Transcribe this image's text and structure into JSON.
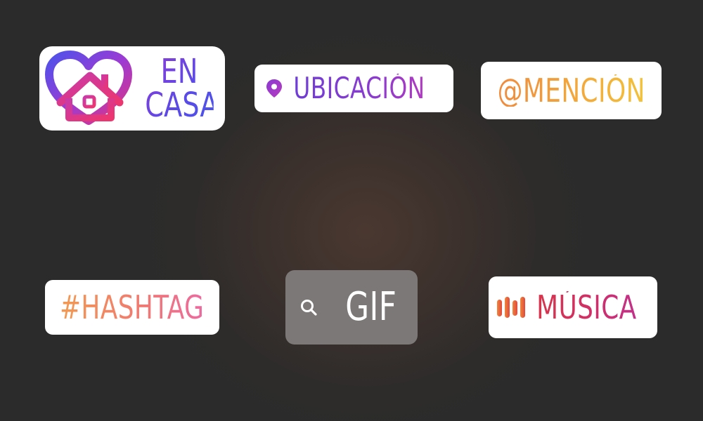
{
  "stickers": {
    "en_casa": {
      "line1": "EN",
      "line2": "CASA",
      "icon": "heart-house-icon"
    },
    "ubicacion": {
      "label": "UBICACIÓN",
      "icon": "location-pin-icon"
    },
    "mencion": {
      "label": "@MENCIÓN"
    },
    "hashtag": {
      "label": "#HASHTAG"
    },
    "gif": {
      "label": "GIF",
      "icon": "search-icon"
    },
    "musica": {
      "label": "MÚSICA",
      "icon": "music-bars-icon"
    }
  },
  "colors": {
    "background": "#2b2b2b",
    "sticker_background": "#ffffff",
    "gif_background": "#7b7877",
    "en_casa": [
      "#8e3ad8",
      "#4b55ec"
    ],
    "ubicacion": [
      "#6f3dd6",
      "#b23ac2"
    ],
    "mencion": [
      "#f08a3c",
      "#f2c23a"
    ],
    "hashtag": [
      "#f39a50",
      "#ec6aa0"
    ],
    "musica": [
      "#d8344a",
      "#c2308a"
    ]
  }
}
